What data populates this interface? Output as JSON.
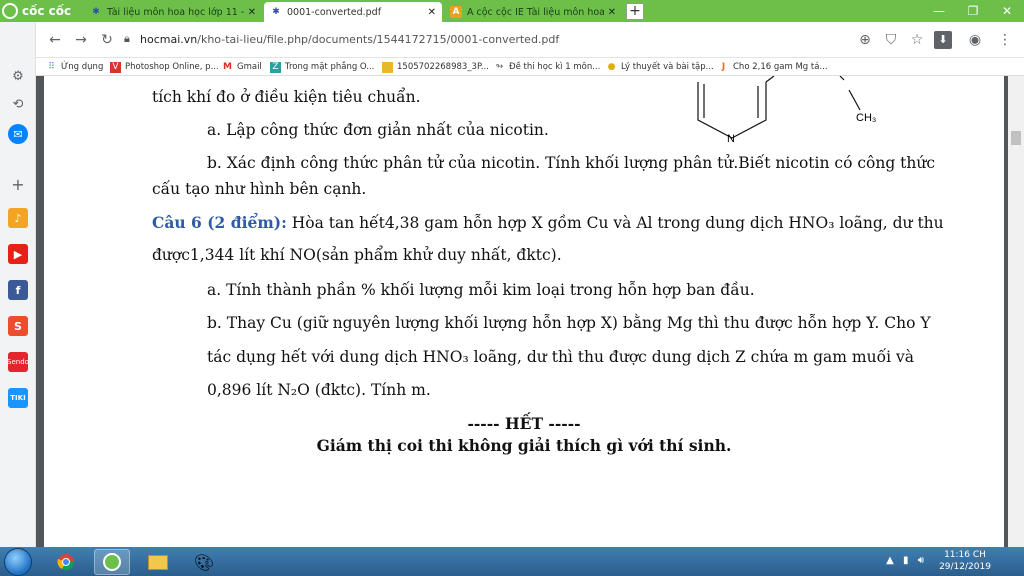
{
  "browser": {
    "brand": "cốc cốc",
    "tabs": [
      {
        "title": "Tài liệu môn hoa học lớp 11 - HOC",
        "active": false
      },
      {
        "title": "0001-converted.pdf",
        "active": true
      },
      {
        "title": "A cộc cộc IE Tài liệu môn hoa học",
        "active": false
      }
    ],
    "new_tab": "+",
    "url_host": "hocmai.vn",
    "url_path": "/kho-tai-lieu/file.php/documents/1544172715/0001-converted.pdf",
    "bookmarks": [
      {
        "label": "Ứng dụng"
      },
      {
        "label": "Photoshop Online, p..."
      },
      {
        "label": "Gmail"
      },
      {
        "label": "Trong mặt phẳng O..."
      },
      {
        "label": "1505702268983_3P..."
      },
      {
        "label": "Đề thi học kì 1 môn..."
      },
      {
        "label": "Lý thuyết và bài tập..."
      },
      {
        "label": "Cho 2,16 gam Mg tá..."
      }
    ]
  },
  "document": {
    "line1": "tích khí đo ở điều kiện tiêu chuẩn.",
    "line2": "a. Lập công thức đơn giản nhất của nicotin.",
    "line3": "b. Xác định công thức phân tử của nicotin. Tính khối lượng phân tử.Biết nicotin có công thức",
    "line4": "cấu tạo như hình bên cạnh.",
    "q6_label": "Câu 6 (2 điểm):",
    "q6_text": " Hòa tan hết4,38 gam hỗn hợp X gồm Cu và Al trong dung dịch HNO₃ loãng, dư thu",
    "line6": "được1,344 lít khí NO(sản phẩm khử duy nhất, đktc).",
    "line7": "a. Tính thành phần % khối lượng mỗi kim loại trong hỗn hợp ban đầu.",
    "line8": "b. Thay Cu (giữ nguyên lượng khối lượng hỗn hợp X) bằng Mg thì thu được hỗn hợp Y. Cho Y",
    "line9": "tác dụng hết với dung dịch HNO₃ loãng, dư thì thu được dung dịch Z chứa m gam muối và",
    "line10": "0,896 lít N₂O (đktc). Tính m.",
    "end": "----- HẾT -----",
    "note": "Giám thị coi thi không giải thích gì với thí sinh.",
    "struct_n": "N",
    "struct_ch3": "CH₃"
  },
  "taskbar": {
    "time": "11:16 CH",
    "date": "29/12/2019"
  }
}
